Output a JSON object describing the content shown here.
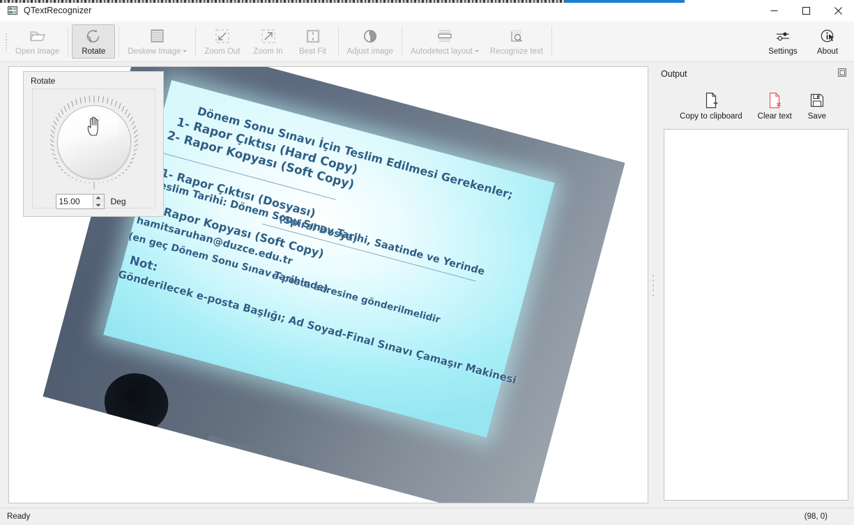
{
  "window": {
    "title": "QTextRecognizer",
    "app_icon": "app-window-icon",
    "minimize": "—",
    "maximize": "□",
    "close": "✕"
  },
  "toolbar": {
    "items": [
      {
        "id": "open-image",
        "label": "Open Image",
        "icon": "folder-open-icon",
        "enabled": false,
        "checked": false,
        "arrow": false
      },
      {
        "id": "rotate",
        "label": "Rotate",
        "icon": "rotate-icon",
        "enabled": true,
        "checked": true,
        "arrow": false
      },
      {
        "id": "deskew-image",
        "label": "Deskew Image",
        "icon": "deskew-lines-icon",
        "enabled": false,
        "checked": false,
        "arrow": true
      },
      {
        "id": "zoom-out",
        "label": "Zoom Out",
        "icon": "zoom-out-icon",
        "enabled": false,
        "checked": false,
        "arrow": false
      },
      {
        "id": "zoom-in",
        "label": "Zoom In",
        "icon": "zoom-in-icon",
        "enabled": false,
        "checked": false,
        "arrow": false
      },
      {
        "id": "best-fit",
        "label": "Best Fit",
        "icon": "best-fit-icon",
        "enabled": false,
        "checked": false,
        "arrow": false
      },
      {
        "id": "adjust-image",
        "label": "Adjust image",
        "icon": "contrast-circle-icon",
        "enabled": false,
        "checked": false,
        "arrow": false
      },
      {
        "id": "autodetect-layout",
        "label": "Autodetect layout",
        "icon": "layout-detect-icon",
        "enabled": false,
        "checked": false,
        "arrow": true
      },
      {
        "id": "recognize-text",
        "label": "Recognize text",
        "icon": "ocr-magnifier-icon",
        "enabled": false,
        "checked": false,
        "arrow": false
      }
    ],
    "right_items": [
      {
        "id": "settings",
        "label": "Settings",
        "icon": "sliders-icon",
        "enabled": true
      },
      {
        "id": "about",
        "label": "About",
        "icon": "info-circle-icon",
        "enabled": true
      }
    ]
  },
  "rotate_panel": {
    "title": "Rotate",
    "dial_name": "rotation-dial",
    "value": "15.00",
    "unit": "Deg",
    "cursor": "pointing-hand-cursor"
  },
  "image_view": {
    "name": "image-canvas",
    "rotation_deg": 15,
    "photo_description": "photographed projected slide",
    "slide_lines": [
      "Dönem Sonu Sınavı İçin Teslim Edilmesi Gerekenler;",
      "1- Rapor Çıktısı (Hard Copy)",
      "2- Rapor Kopyası (Soft Copy)",
      "1- Rapor Çıktısı (Dosyası)",
      "(Spiral Dosya)",
      "Teslim Tarihi: Dönem Sonu Sınav Tarihi, Saatinde ve Yerinde",
      "2- Rapor Kopyası (Soft Copy)",
      "hamitsaruhan@duzce.edu.tr",
      "e-posta adresine gönderilmelidir",
      "(en geç Dönem Sonu Sınav Tarihinde)",
      "Not:",
      "Gönderilecek e-posta Başlığı; Ad Soyad-Final Sınavı Çamaşır Makinesi"
    ]
  },
  "output": {
    "title": "Output",
    "float_icon": "undock-icon",
    "actions": [
      {
        "id": "copy-to-clipboard",
        "label": "Copy to clipboard",
        "icon": "document-plus-icon"
      },
      {
        "id": "clear-text",
        "label": "Clear text",
        "icon": "document-delete-icon"
      },
      {
        "id": "save",
        "label": "Save",
        "icon": "floppy-save-icon"
      }
    ],
    "text_value": "",
    "text_placeholder": ""
  },
  "statusbar": {
    "message": "Ready",
    "coordinates": "(98, 0)"
  },
  "colors": {
    "accent": "#1b7fd4",
    "panel": "#f0f0f0",
    "toolbar": "#f5f5f5",
    "slide_text": "#2b5f86",
    "clear_red": "#e05a5a"
  }
}
